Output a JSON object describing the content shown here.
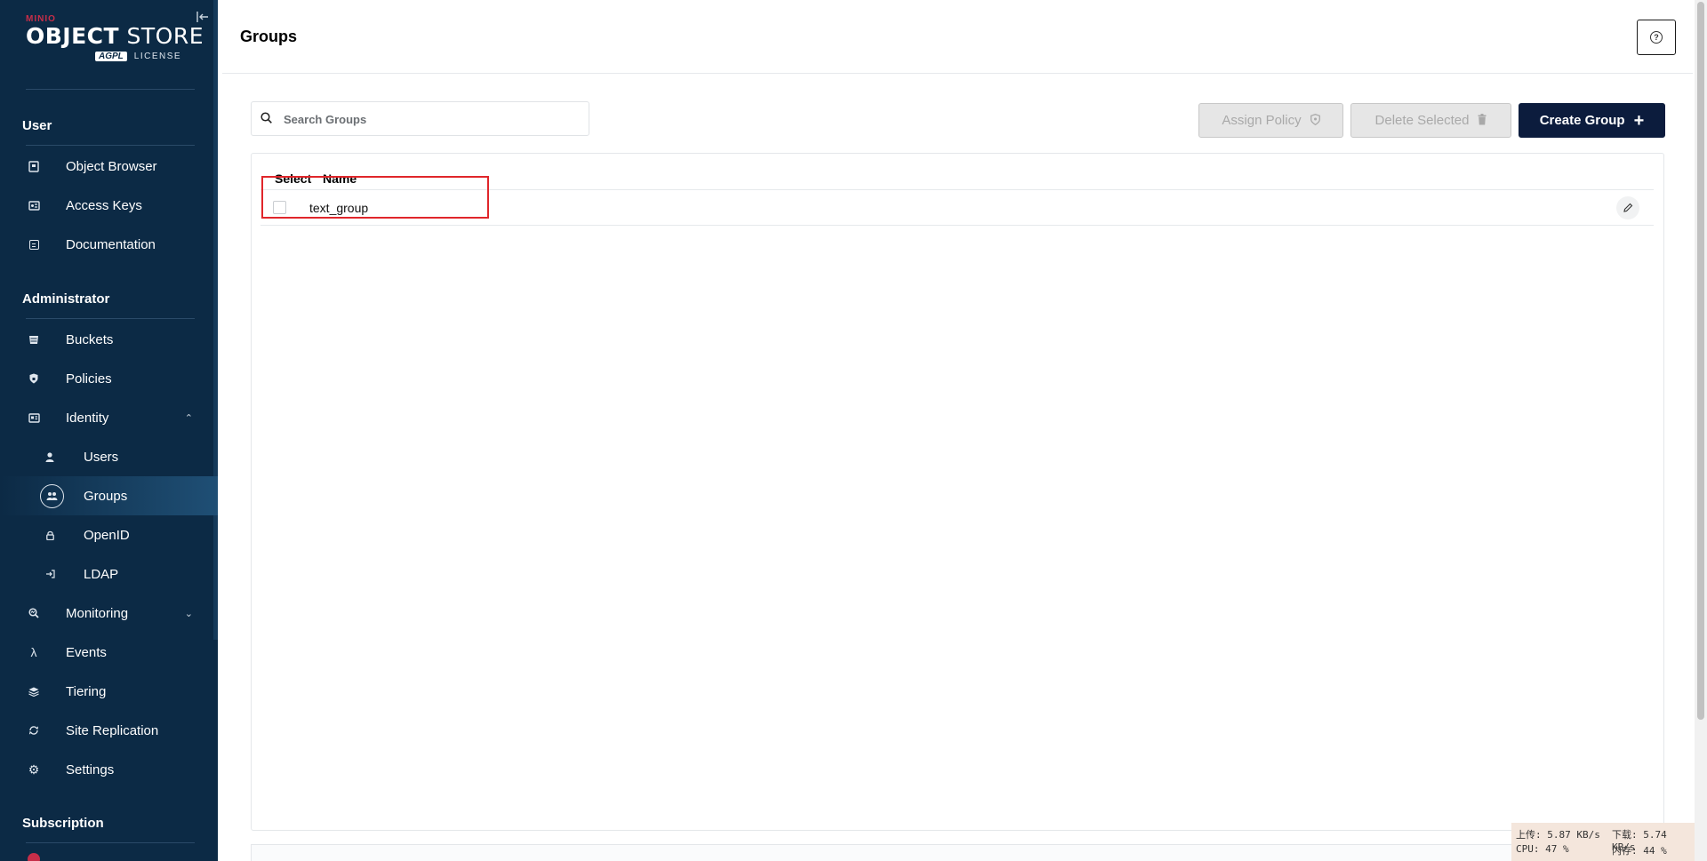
{
  "sidebar": {
    "logo": {
      "brand": "MINIO",
      "product_bold": "OBJECT",
      "product_light": " STORE",
      "license_badge": "AGPL",
      "license_text": "LICENSE"
    },
    "sections": {
      "user": "User",
      "administrator": "Administrator",
      "subscription": "Subscription"
    },
    "items": {
      "object_browser": "Object Browser",
      "access_keys": "Access Keys",
      "documentation": "Documentation",
      "buckets": "Buckets",
      "policies": "Policies",
      "identity": "Identity",
      "users": "Users",
      "groups": "Groups",
      "openid": "OpenID",
      "ldap": "LDAP",
      "monitoring": "Monitoring",
      "events": "Events",
      "tiering": "Tiering",
      "site_replication": "Site Replication",
      "settings": "Settings"
    }
  },
  "header": {
    "title": "Groups"
  },
  "toolbar": {
    "search_placeholder": "Search Groups",
    "assign_policy": "Assign Policy",
    "delete_selected": "Delete Selected",
    "create_group": "Create Group"
  },
  "table": {
    "columns": {
      "select": "Select",
      "name": "Name"
    },
    "rows": [
      {
        "name": "text_group",
        "selected": false
      }
    ]
  },
  "netmon": {
    "upload": "上传: 5.87 KB/s",
    "download": "下载: 5.74 KB/s",
    "cpu": "CPU: 47 %",
    "memory": "内存: 44 %"
  },
  "colors": {
    "sidebar_bg": "#0c2a45",
    "primary_button": "#0c1c3d",
    "highlight_box": "#e0262b",
    "brand_red": "#c72e49"
  }
}
